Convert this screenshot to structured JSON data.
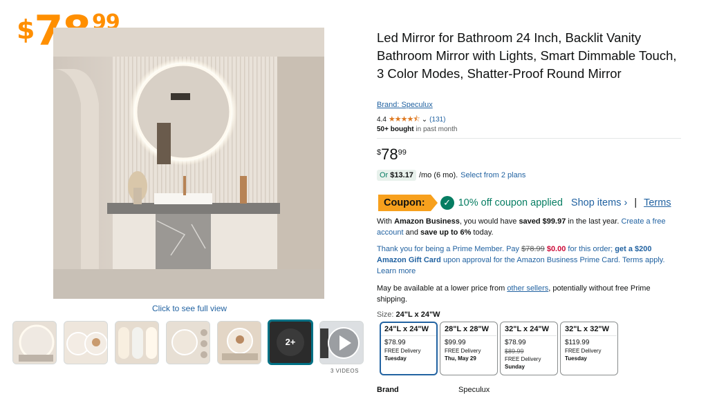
{
  "overlay_price": {
    "currency": "$",
    "whole": "78",
    "fraction": "99"
  },
  "gallery": {
    "full_view_label": "Click to see full view",
    "more_label": "2+",
    "videos_label": "3 VIDEOS"
  },
  "product": {
    "title": "Led Mirror for Bathroom 24 Inch, Backlit Vanity Bathroom Mirror with Lights, Smart Dimmable Touch, 3 Color Modes, Shatter-Proof Round Mirror",
    "brand_link": "Brand: Speculux",
    "rating": "4.4",
    "stars": "★★★★⯪",
    "review_count": "(131)",
    "bought_bold": "50+ bought",
    "bought_rest": " in past month"
  },
  "price": {
    "currency": "$",
    "whole": "78",
    "fraction": "99"
  },
  "plans": {
    "prefix": "Or ",
    "amount": "$13.17",
    "suffix": "/mo (6 mo).",
    "link": "Select from 2 plans"
  },
  "coupon": {
    "badge": "Coupon:",
    "text": "10% off coupon applied",
    "shop_items": "Shop items ›",
    "separator": "|",
    "terms": "Terms"
  },
  "business": {
    "p1": "With ",
    "p2": "Amazon Business",
    "p3": ", you would have ",
    "p4": "saved $99.97",
    "p5": " in the last year. ",
    "link": "Create a free account",
    "p6": " and ",
    "p7": "save up to 6%",
    "p8": " today."
  },
  "prime": {
    "p1": "Thank you for being a Prime Member. Pay ",
    "strike": "$78.99",
    "red": " $0.00",
    "p2": " for this order; ",
    "bold": "get a $200 Amazon Gift Card",
    "p3": " upon approval for the Amazon Business Prime Card. Terms apply. Learn more"
  },
  "sellers": {
    "p1": "May be available at a lower price from ",
    "link": "other sellers",
    "p2": ", potentially without free Prime shipping."
  },
  "size": {
    "label": "Size: ",
    "selected": "24\"L x 24\"W",
    "options": [
      {
        "dim": "24\"L x 24\"W",
        "price": "$78.99",
        "old": "",
        "delivery": "FREE Delivery",
        "day": "Tuesday"
      },
      {
        "dim": "28\"L x 28\"W",
        "price": "$99.99",
        "old": "",
        "delivery": "FREE Delivery",
        "day": "Thu, May 29"
      },
      {
        "dim": "32\"L x 24\"W",
        "price": "$78.99",
        "old": "$89.99",
        "delivery": "FREE Delivery",
        "day": "Sunday"
      },
      {
        "dim": "32\"L x 32\"W",
        "price": "$119.99",
        "old": "",
        "delivery": "FREE Delivery",
        "day": "Tuesday"
      }
    ]
  },
  "specs": {
    "brand_key": "Brand",
    "brand_value": "Speculux"
  },
  "colors": {
    "accent_orange": "#ff8f00",
    "link": "#2162a1",
    "green": "#067d62",
    "coupon": "#f7a01d"
  }
}
